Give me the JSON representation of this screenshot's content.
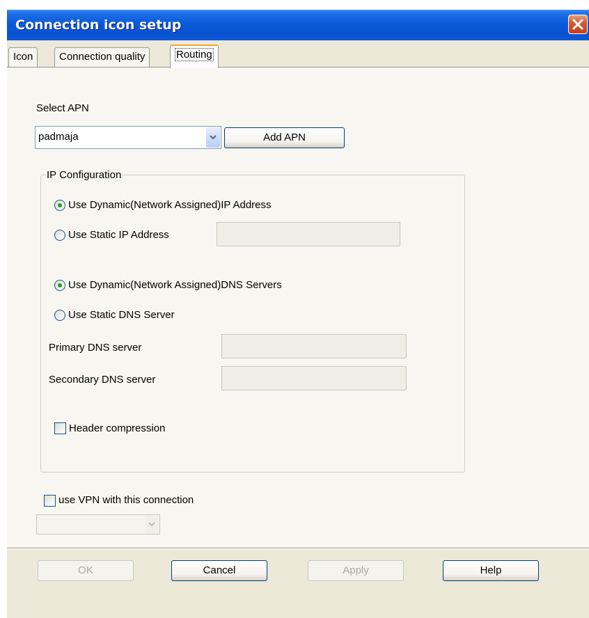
{
  "window": {
    "title": "Connection icon setup"
  },
  "tabs": [
    {
      "label": "Icon"
    },
    {
      "label": "Connection quality"
    },
    {
      "label": "Routing",
      "active": true
    }
  ],
  "apn": {
    "label": "Select APN",
    "selected": "padmaja",
    "add_button": "Add APN"
  },
  "ip_config": {
    "title": "IP Configuration",
    "dynamic_ip_label": "Use Dynamic(Network Assigned)IP Address",
    "dynamic_ip_checked": true,
    "static_ip_label": "Use Static IP Address",
    "static_ip_value": "",
    "dynamic_dns_label": "Use Dynamic(Network Assigned)DNS Servers",
    "dynamic_dns_checked": true,
    "static_dns_label": "Use Static DNS Server",
    "primary_dns_label": "Primary DNS server",
    "primary_dns_value": "",
    "secondary_dns_label": "Secondary DNS server",
    "secondary_dns_value": "",
    "header_compression_label": "Header compression",
    "header_compression_checked": false
  },
  "vpn": {
    "label": "use VPN with this connection",
    "checked": false,
    "selected": ""
  },
  "buttons": {
    "ok": "OK",
    "cancel": "Cancel",
    "apply": "Apply",
    "help": "Help"
  },
  "colors": {
    "titlebar": "#0A52D0",
    "dialog_bg": "#ECE9D8",
    "radio_dot": "#21A121",
    "close_button": "#D85A30"
  }
}
